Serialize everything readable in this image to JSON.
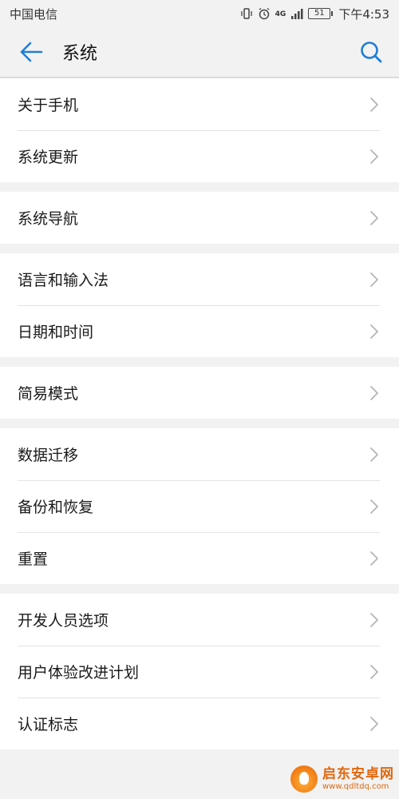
{
  "status_bar": {
    "carrier": "中国电信",
    "network": "4G",
    "battery": "51",
    "time": "下午4:53",
    "icons": [
      "vibrate-icon",
      "alarm-icon",
      "signal-icon",
      "battery-icon"
    ]
  },
  "app_bar": {
    "title": "系统",
    "back_icon": "back-arrow-icon",
    "search_icon": "search-icon",
    "accent_color": "#1e7fd6"
  },
  "groups": [
    {
      "items": [
        {
          "label": "关于手机"
        },
        {
          "label": "系统更新"
        }
      ]
    },
    {
      "items": [
        {
          "label": "系统导航"
        }
      ]
    },
    {
      "items": [
        {
          "label": "语言和输入法"
        },
        {
          "label": "日期和时间"
        }
      ]
    },
    {
      "items": [
        {
          "label": "简易模式"
        }
      ]
    },
    {
      "items": [
        {
          "label": "数据迁移"
        },
        {
          "label": "备份和恢复"
        },
        {
          "label": "重置"
        }
      ]
    },
    {
      "items": [
        {
          "label": "开发人员选项"
        },
        {
          "label": "用户体验改进计划"
        },
        {
          "label": "认证标志"
        }
      ]
    }
  ],
  "watermark": {
    "name": "启东安卓网",
    "url": "www.qdltdq.com"
  }
}
